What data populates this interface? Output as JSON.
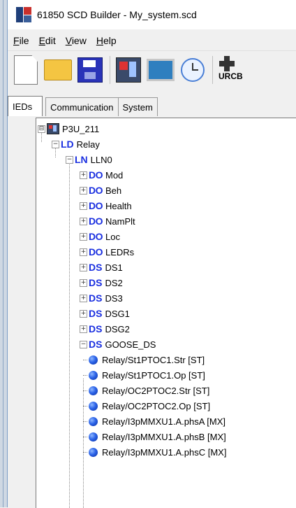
{
  "window": {
    "title": "61850 SCD Builder - My_system.scd"
  },
  "menu": {
    "items": [
      "File",
      "Edit",
      "View",
      "Help"
    ]
  },
  "toolbar": {
    "buttons": [
      "new-file-icon",
      "open-folder-icon",
      "save-disk-icon",
      "ied-icon",
      "monitor-icon",
      "clock-icon",
      "urcb-icon"
    ],
    "urcb_label": "URCB"
  },
  "tabs": [
    {
      "label": "IEDs",
      "active": true
    },
    {
      "label": "Communication",
      "active": false
    },
    {
      "label": "System",
      "active": false
    }
  ],
  "tree": {
    "ied": {
      "expander": "⊟",
      "label": "P3U_211"
    },
    "ld": {
      "prefix": "LD",
      "label": "Relay"
    },
    "ln": {
      "prefix": "LN",
      "label": "LLN0"
    },
    "items": [
      {
        "prefix": "DO",
        "label": "Mod"
      },
      {
        "prefix": "DO",
        "label": "Beh"
      },
      {
        "prefix": "DO",
        "label": "Health"
      },
      {
        "prefix": "DO",
        "label": "NamPlt"
      },
      {
        "prefix": "DO",
        "label": "Loc"
      },
      {
        "prefix": "DO",
        "label": "LEDRs"
      },
      {
        "prefix": "DS",
        "label": "DS1"
      },
      {
        "prefix": "DS",
        "label": "DS2"
      },
      {
        "prefix": "DS",
        "label": "DS3"
      },
      {
        "prefix": "DS",
        "label": "DSG1"
      },
      {
        "prefix": "DS",
        "label": "DSG2"
      },
      {
        "prefix": "DS",
        "label": "GOOSE_DS"
      }
    ],
    "goose_entries": [
      "Relay/St1PTOC1.Str [ST]",
      "Relay/St1PTOC1.Op [ST]",
      "Relay/OC2PTOC2.Str [ST]",
      "Relay/OC2PTOC2.Op [ST]",
      "Relay/I3pMMXU1.A.phsA [MX]",
      "Relay/I3pMMXU1.A.phsB [MX]",
      "Relay/I3pMMXU1.A.phsC [MX]"
    ]
  }
}
